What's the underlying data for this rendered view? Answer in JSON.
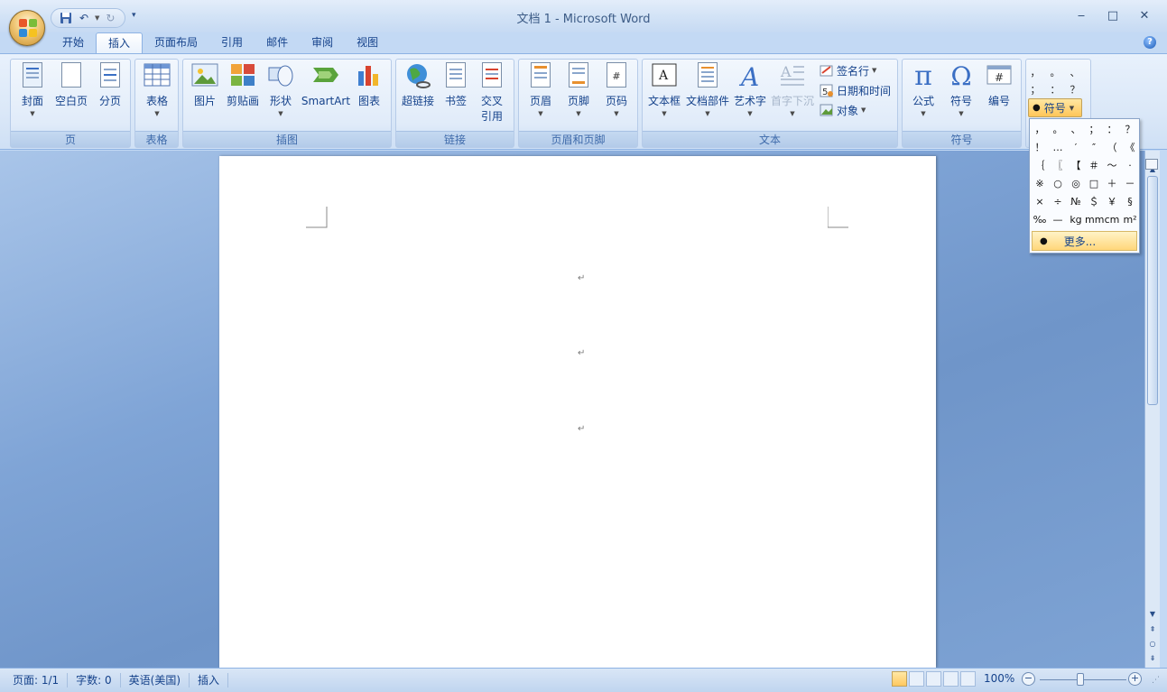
{
  "window": {
    "title": "文档 1 - Microsoft Word",
    "minimize": "‒",
    "maximize": "□",
    "close": "✕"
  },
  "tabs": [
    "开始",
    "插入",
    "页面布局",
    "引用",
    "邮件",
    "审阅",
    "视图"
  ],
  "active_tab": "插入",
  "ribbon": {
    "groups": {
      "pages": {
        "label": "页",
        "buttons": [
          "封面",
          "空白页",
          "分页"
        ]
      },
      "table": {
        "label": "表格",
        "buttons": [
          "表格"
        ]
      },
      "illustrations": {
        "label": "插图",
        "buttons": [
          "图片",
          "剪贴画",
          "形状",
          "SmartArt",
          "图表"
        ]
      },
      "links": {
        "label": "链接",
        "buttons": [
          "超链接",
          "书签",
          "交叉",
          "引用"
        ]
      },
      "header_footer": {
        "label": "页眉和页脚",
        "buttons": [
          "页眉",
          "页脚",
          "页码"
        ]
      },
      "text": {
        "label": "文本",
        "buttons": [
          "文本框",
          "文档部件",
          "艺术字",
          "首字下沉"
        ],
        "small_buttons": [
          "签名行",
          "日期和时间",
          "对象"
        ]
      },
      "symbols": {
        "label": "符号",
        "buttons": [
          "公式",
          "符号",
          "编号"
        ]
      }
    },
    "quick_symbols": [
      "，",
      "。",
      "、",
      "；",
      "：",
      "？"
    ],
    "symbol_dropdown": "符号"
  },
  "symbol_panel": {
    "rows": [
      [
        "，",
        "。",
        "、",
        "；",
        "：",
        "？"
      ],
      [
        "！",
        "…",
        "′",
        "″",
        "（",
        "《"
      ],
      [
        "｛",
        "〖",
        "【",
        "＃",
        "～",
        "·"
      ],
      [
        "※",
        "○",
        "◎",
        "□",
        "＋",
        "－"
      ],
      [
        "×",
        "÷",
        "№",
        "＄",
        "￥",
        "§"
      ],
      [
        "‰",
        "—",
        "kg",
        "mm",
        "cm",
        "m²"
      ]
    ],
    "more": "更多..."
  },
  "document": {
    "paragraph_mark": "↵"
  },
  "statusbar": {
    "page": "页面: 1/1",
    "words": "字数: 0",
    "language": "英语(美国)",
    "mode": "插入",
    "zoom": "100%",
    "zoom_level_percent": 100
  }
}
